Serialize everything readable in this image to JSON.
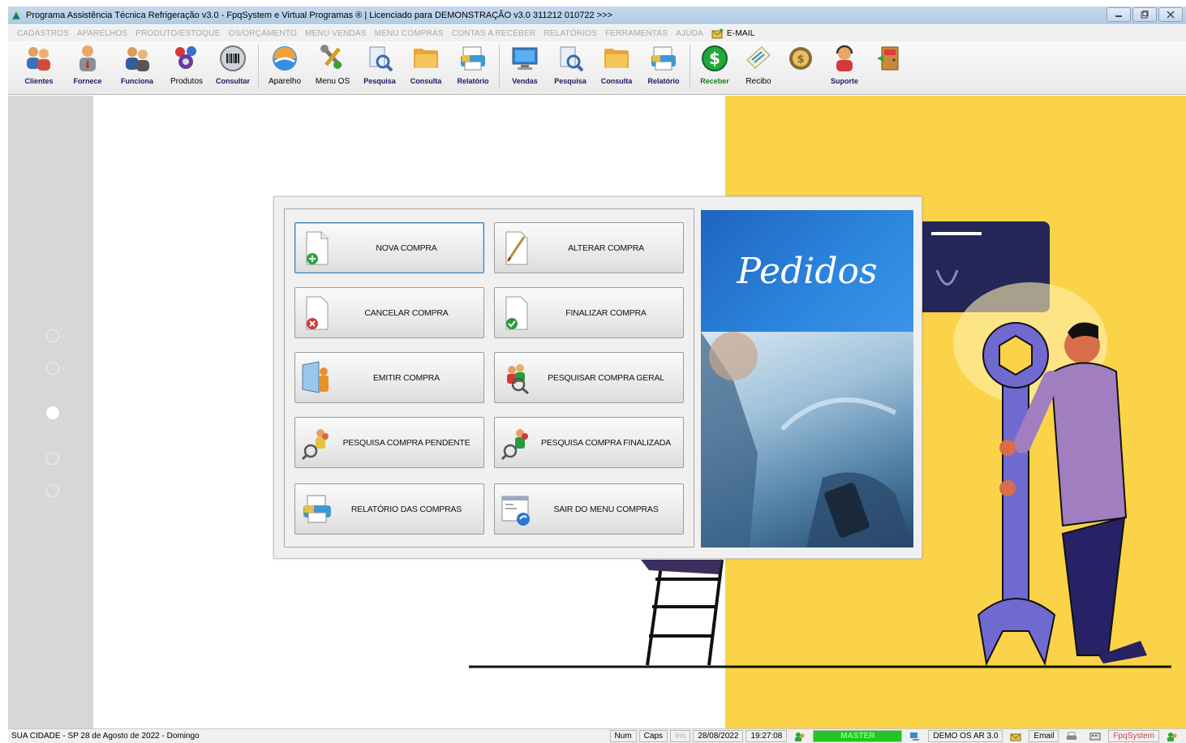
{
  "window": {
    "title": "Programa Assistência Técnica Refrigeração v3.0 - FpqSystem e Virtual Programas ® | Licenciado para  DEMONSTRAÇÃO v3.0 311212 010722 >>>"
  },
  "menu": {
    "items": [
      "CADASTROS",
      "APARELHOS",
      "PRODUTO/ESTOQUE",
      "OS/ORÇAMENTO",
      "MENU VENDAS",
      "MENU COMPRAS",
      "CONTAS A RECEBER",
      "RELATÓRIOS",
      "FERRAMENTAS",
      "AJUDA"
    ],
    "email": "E-MAIL"
  },
  "toolbar": {
    "clientes": "Clientes",
    "fornece": "Fornece",
    "funciona": "Funciona",
    "produtos": "Produtos",
    "consultar": "Consultar",
    "aparelho": "Aparelho",
    "menu_os": "Menu OS",
    "pesquisa1": "Pesquisa",
    "consulta1": "Consulta",
    "relatorio1": "Relatório",
    "vendas": "Vendas",
    "pesquisa2": "Pesquisa",
    "consulta2": "Consulta",
    "relatorio2": "Relatório",
    "receber": "Receber",
    "recibo": "Recibo",
    "suporte": "Suporte"
  },
  "dialog": {
    "nova_compra": "NOVA COMPRA",
    "alterar_compra": "ALTERAR COMPRA",
    "cancelar_compra": "CANCELAR COMPRA",
    "finalizar_compra": "FINALIZAR COMPRA",
    "emitir_compra": "EMITIR COMPRA",
    "pesquisar_geral": "PESQUISAR COMPRA GERAL",
    "pesquisa_pendente": "PESQUISA COMPRA PENDENTE",
    "pesquisa_finalizada": "PESQUISA COMPRA FINALIZADA",
    "relatorio": "RELATÓRIO DAS COMPRAS",
    "sair": "SAIR DO MENU COMPRAS",
    "panel_title": "Pedidos"
  },
  "status": {
    "location": "SUA CIDADE - SP 28 de Agosto de 2022 - Domingo",
    "num": "Num",
    "caps": "Caps",
    "ins": "Ins",
    "date": "28/08/2022",
    "time": "19:27:08",
    "user": "MASTER",
    "version": "DEMO OS AR 3.0",
    "email": "Email",
    "brand": "FpqSystem"
  },
  "colors": {
    "accent_yellow": "#fbd348",
    "master_green": "#22c622",
    "panel_blue": "#2c86de"
  }
}
